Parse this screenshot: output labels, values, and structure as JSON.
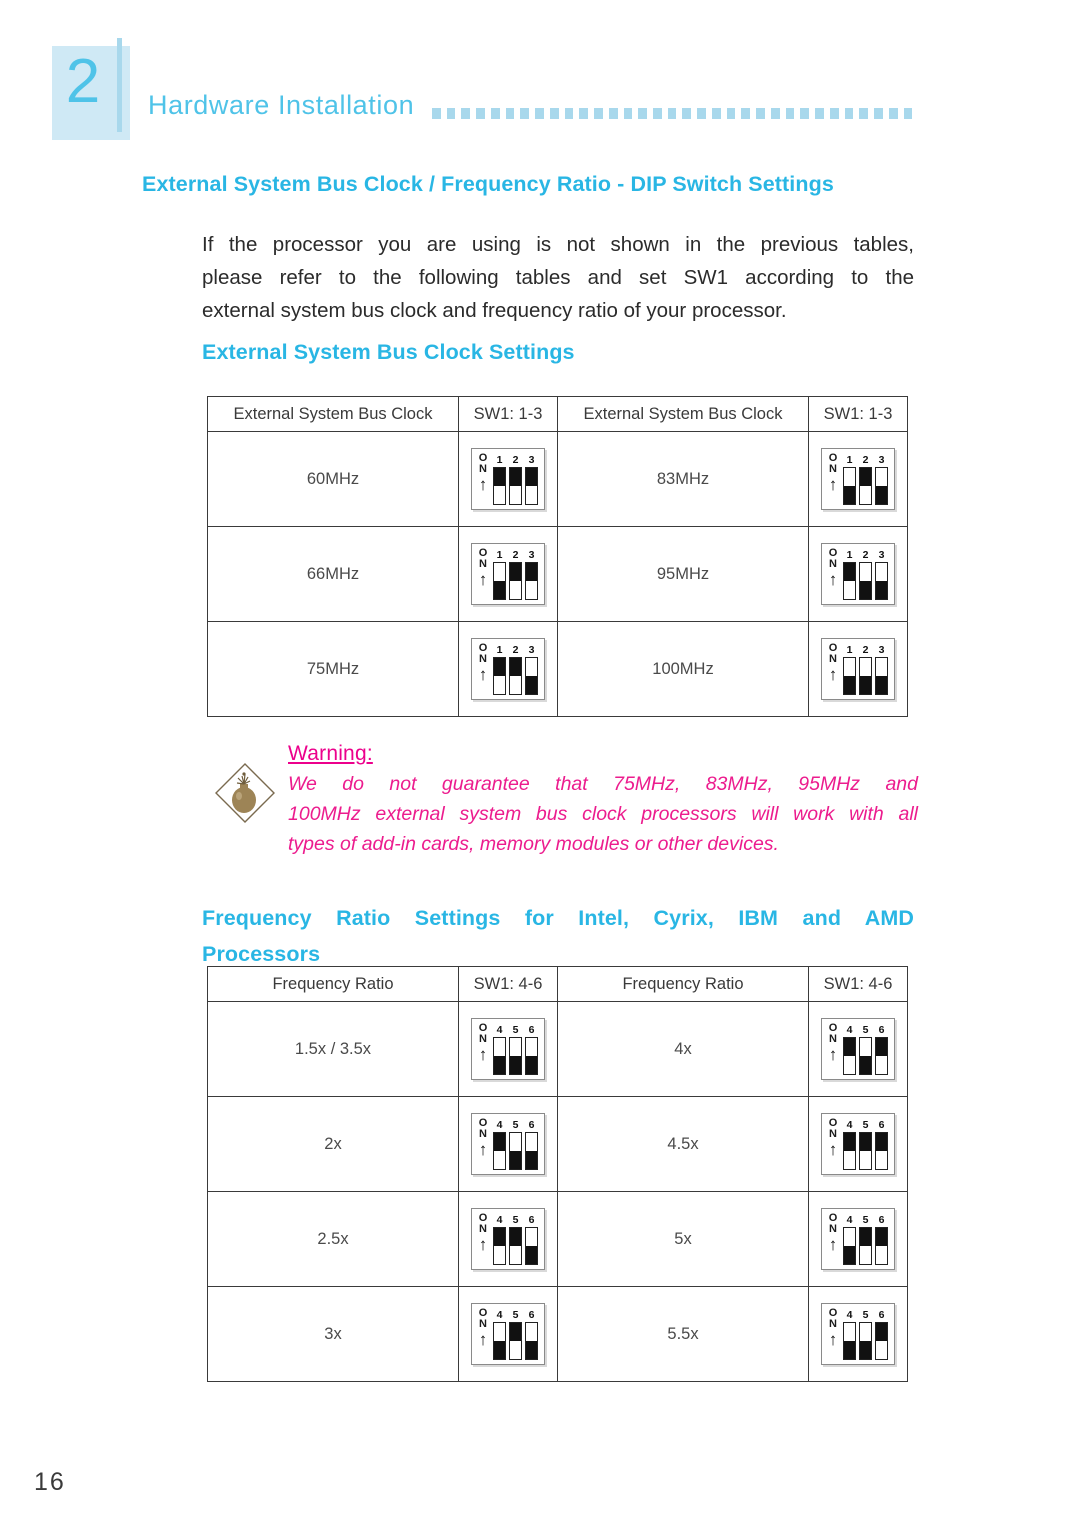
{
  "chapter": {
    "number": "2",
    "title": "Hardware Installation",
    "dot_count": 33
  },
  "headings": {
    "dip_switch_settings": "External System Bus Clock / Frequency Ratio - DIP Switch Settings",
    "bus_clock_settings": "External System Bus Clock Settings",
    "frequency_ratio_line1": "Frequency Ratio Settings for Intel, Cyrix, IBM and AMD",
    "frequency_ratio_line2": "Processors"
  },
  "intro_paragraph": {
    "line1": "If the processor you are using is not shown in the previous tables,",
    "line2": "please refer to the following tables and set SW1 according to the",
    "line3": "external system bus clock and frequency ratio of your processor."
  },
  "bus_clock_table": {
    "headers": [
      "External System Bus Clock",
      "SW1: 1-3",
      "External System Bus Clock",
      "SW1: 1-3"
    ],
    "switch_numbers": [
      "1",
      "2",
      "3"
    ],
    "on_label_top": "O",
    "on_label_bottom": "N",
    "rows": [
      {
        "left_label": "60MHz",
        "left_switches": [
          "on",
          "on",
          "on"
        ],
        "right_label": "83MHz",
        "right_switches": [
          "off",
          "on",
          "off"
        ]
      },
      {
        "left_label": "66MHz",
        "left_switches": [
          "off",
          "on",
          "on"
        ],
        "right_label": "95MHz",
        "right_switches": [
          "on",
          "off",
          "off"
        ]
      },
      {
        "left_label": "75MHz",
        "left_switches": [
          "on",
          "on",
          "off"
        ],
        "right_label": "100MHz",
        "right_switches": [
          "off",
          "off",
          "off"
        ]
      }
    ]
  },
  "warning": {
    "icon": "bomb-diamond-icon",
    "title": "Warning:",
    "line1": "We do not guarantee that 75MHz, 83MHz, 95MHz and",
    "line2": "100MHz external system bus clock processors will work with all",
    "line3": "types of add-in cards, memory modules or other devices.",
    "color": "#ec1c8e"
  },
  "frequency_ratio_table": {
    "headers": [
      "Frequency Ratio",
      "SW1: 4-6",
      "Frequency Ratio",
      "SW1: 4-6"
    ],
    "switch_numbers": [
      "4",
      "5",
      "6"
    ],
    "on_label_top": "O",
    "on_label_bottom": "N",
    "rows": [
      {
        "left_label": "1.5x / 3.5x",
        "left_switches": [
          "off",
          "off",
          "off"
        ],
        "right_label": "4x",
        "right_switches": [
          "on",
          "off",
          "on"
        ]
      },
      {
        "left_label": "2x",
        "left_switches": [
          "on",
          "off",
          "off"
        ],
        "right_label": "4.5x",
        "right_switches": [
          "on",
          "on",
          "on"
        ]
      },
      {
        "left_label": "2.5x",
        "left_switches": [
          "on",
          "on",
          "off"
        ],
        "right_label": "5x",
        "right_switches": [
          "off",
          "on",
          "on"
        ]
      },
      {
        "left_label": "3x",
        "left_switches": [
          "off",
          "on",
          "off"
        ],
        "right_label": "5.5x",
        "right_switches": [
          "off",
          "off",
          "on"
        ]
      }
    ]
  },
  "page_number": "16",
  "colors": {
    "accent": "#4fc3e8",
    "heading": "#29b6e4",
    "warning": "#ec1c8e",
    "dots": "#a8d8ec",
    "text": "#2b2b2b"
  }
}
